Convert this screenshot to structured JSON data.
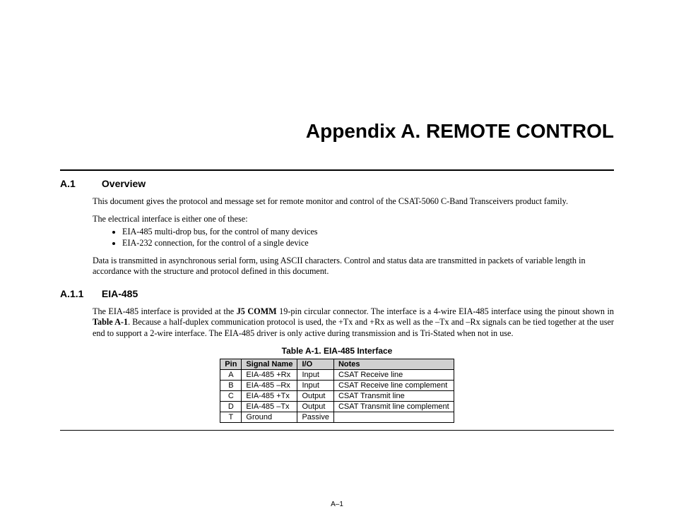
{
  "title": "Appendix A.  REMOTE CONTROL",
  "section_a1": {
    "num": "A.1",
    "label": "Overview",
    "p1": "This document gives the protocol and message set for remote monitor and control of the CSAT-5060 C-Band Transceivers product family.",
    "p2": "The electrical interface is either one of these:",
    "bullets": [
      "EIA-485 multi-drop bus, for the control of many devices",
      "EIA-232 connection, for the control of a single device"
    ],
    "p3": "Data is transmitted in asynchronous serial form, using ASCII characters. Control and status data are transmitted in packets of variable length in accordance with the structure and protocol defined in this document."
  },
  "section_a11": {
    "num": "A.1.1",
    "label": "EIA-485",
    "p1_pre": "The EIA-485 interface is provided at the ",
    "p1_bold1": "J5 COMM",
    "p1_mid": " 19-pin circular connector.  The interface is a 4-wire EIA-485 interface using the pinout shown in ",
    "p1_bold2": "Table A-1",
    "p1_post": ".  Because a half-duplex communication protocol is used, the +Tx and +Rx as well as the –Tx and –Rx signals can be tied together at the user end to support a 2-wire interface.  The EIA-485 driver is only active during transmission and is Tri-Stated when not in use."
  },
  "table": {
    "caption": "Table A-1. EIA-485 Interface",
    "headers": [
      "Pin",
      "Signal Name",
      "I/O",
      "Notes"
    ],
    "rows": [
      [
        "A",
        "EIA-485 +Rx",
        "Input",
        "CSAT Receive line"
      ],
      [
        "B",
        "EIA-485 –Rx",
        "Input",
        "CSAT Receive line complement"
      ],
      [
        "C",
        "EIA-485 +Tx",
        "Output",
        "CSAT Transmit line"
      ],
      [
        "D",
        "EIA-485 –Tx",
        "Output",
        "CSAT Transmit line complement"
      ],
      [
        "T",
        "Ground",
        "Passive",
        ""
      ]
    ]
  },
  "page_number": "A–1"
}
